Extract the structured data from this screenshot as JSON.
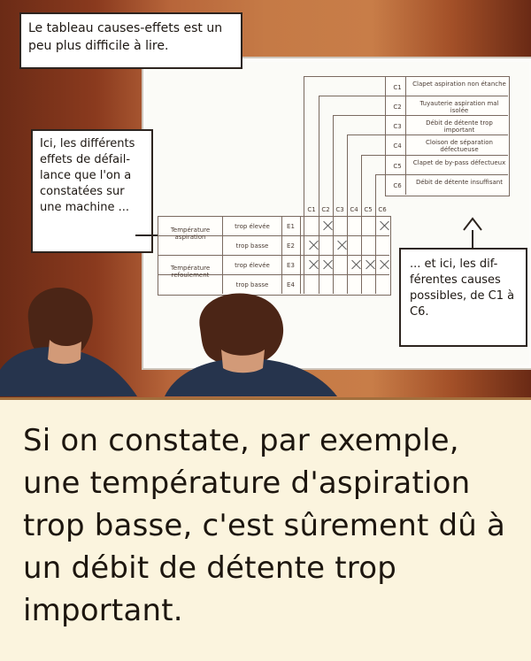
{
  "captions": {
    "top": "Le tableau causes-effets est un peu plus difficile à lire.",
    "left": "Ici, les différents effets de défail-lance que l'on a constatées sur une machine ...",
    "right": "... et ici, les dif-férentes causes possibles, de C1 à C6."
  },
  "table": {
    "rows": [
      {
        "group": "Température aspiration",
        "state": "trop élevée",
        "code": "E1"
      },
      {
        "group": "Température aspiration",
        "state": "trop basse",
        "code": "E2"
      },
      {
        "group": "Température refoulement",
        "state": "trop élevée",
        "code": "E3"
      },
      {
        "group": "Température refoulement",
        "state": "trop basse",
        "code": "E4"
      }
    ],
    "causes": [
      {
        "code": "C1",
        "label": "Clapet aspiration non étanche"
      },
      {
        "code": "C2",
        "label": "Tuyauterie aspiration mal isolée"
      },
      {
        "code": "C3",
        "label": "Débit de détente trop important"
      },
      {
        "code": "C4",
        "label": "Cloison de séparation défectueuse"
      },
      {
        "code": "C5",
        "label": "Clapet de by-pass défectueux"
      },
      {
        "code": "C6",
        "label": "Débit de détente insuffisant"
      }
    ],
    "column_headers": [
      "C1",
      "C2",
      "C3",
      "C4",
      "C5",
      "C6"
    ]
  },
  "bottom_text": "Si on constate, par exemple, une température d'aspiration trop basse, c'est sûrement dû à un débit de détente trop important."
}
